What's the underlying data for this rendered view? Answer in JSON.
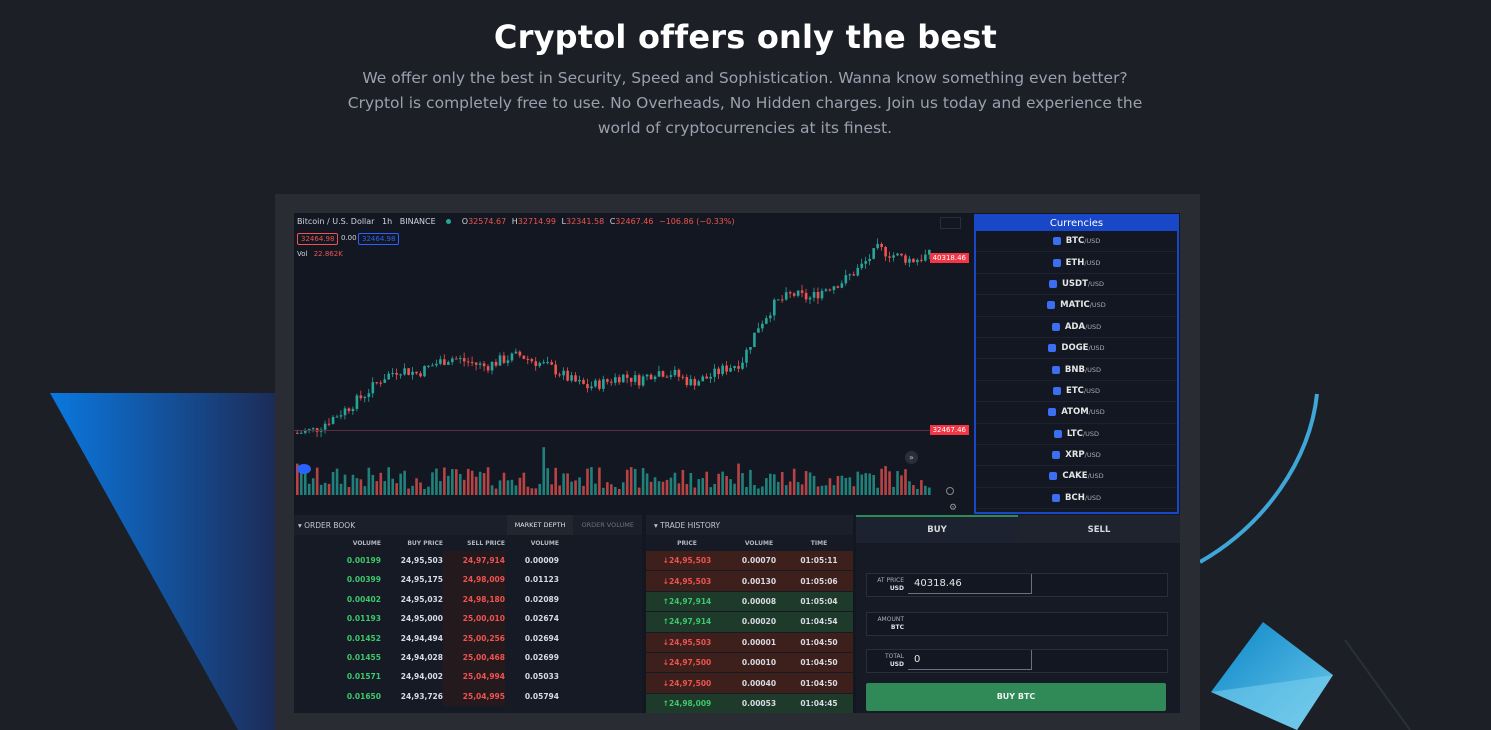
{
  "hero": {
    "title": "Cryptol offers only the best",
    "subtitle_lines": [
      "We offer only the best in Security, Speed and Sophistication. Wanna know something even better?",
      "Cryptol is completely free to use. No Overheads, No Hidden charges. Join us today and experience the",
      "world of cryptocurrencies at its finest."
    ]
  },
  "chart": {
    "symbol": "Bitcoin / U.S. Dollar",
    "interval": "1h",
    "exchange": "BINANCE",
    "o_label": "O",
    "o": "32574.67",
    "h_label": "H",
    "h": "32714.99",
    "l_label": "L",
    "l": "32341.58",
    "c_label": "C",
    "c": "32467.46",
    "change": "−106.86 (−0.33%)",
    "bid": "32464.98",
    "spread": "0.00",
    "ask": "32464.98",
    "vol_label": "Vol",
    "vol_value": "22.862K",
    "last_price_tag": "40318.46",
    "mid_price_tag": "32467.46"
  },
  "chart_data": {
    "type": "candlestick",
    "title": "Bitcoin / U.S. Dollar",
    "interval": "1h",
    "open": 32574.67,
    "high": 32714.99,
    "low": 32341.58,
    "close": 32467.46,
    "last_price": 40318.46,
    "trend_closes": [
      32467,
      32600,
      33100,
      33600,
      34200,
      34900,
      35300,
      35100,
      35500,
      35800,
      35600,
      35400,
      35700,
      35900,
      35600,
      35300,
      34800,
      34500,
      34700,
      35000,
      34800,
      35200,
      35100,
      34700,
      34900,
      35300,
      35600,
      37200,
      38200,
      38600,
      38400,
      38900,
      39200,
      39800,
      40600,
      40300,
      40100,
      40318
    ],
    "volume_label": "22.862K",
    "colors": {
      "up": "#26a69a",
      "down": "#ef5350"
    }
  },
  "currencies": {
    "title": "Currencies",
    "items": [
      {
        "sym": "BTC",
        "quote": "/USD",
        "icon": "bitcoin-icon",
        "color": "#3b6ef0"
      },
      {
        "sym": "ETH",
        "quote": "/USD",
        "icon": "ethereum-icon",
        "color": "#3b6ef0"
      },
      {
        "sym": "USDT",
        "quote": "/USD",
        "icon": "tether-icon",
        "color": "#3b6ef0"
      },
      {
        "sym": "MATIC",
        "quote": "/USD",
        "icon": "polygon-icon",
        "color": "#3b6ef0"
      },
      {
        "sym": "ADA",
        "quote": "/USD",
        "icon": "cardano-icon",
        "color": "#3b6ef0"
      },
      {
        "sym": "DOGE",
        "quote": "/USD",
        "icon": "dogecoin-icon",
        "color": "#3b6ef0"
      },
      {
        "sym": "BNB",
        "quote": "/USD",
        "icon": "binance-coin-icon",
        "color": "#3b6ef0"
      },
      {
        "sym": "ETC",
        "quote": "/USD",
        "icon": "ethereum-classic-icon",
        "color": "#3b6ef0"
      },
      {
        "sym": "ATOM",
        "quote": "/USD",
        "icon": "cosmos-icon",
        "color": "#3b6ef0"
      },
      {
        "sym": "LTC",
        "quote": "/USD",
        "icon": "litecoin-icon",
        "color": "#3b6ef0"
      },
      {
        "sym": "XRP",
        "quote": "/USD",
        "icon": "ripple-icon",
        "color": "#3b6ef0"
      },
      {
        "sym": "CAKE",
        "quote": "/USD",
        "icon": "pancakeswap-icon",
        "color": "#3b6ef0"
      },
      {
        "sym": "BCH",
        "quote": "/USD",
        "icon": "bitcoin-cash-icon",
        "color": "#3b6ef0"
      }
    ]
  },
  "order_book": {
    "title": "ORDER BOOK",
    "tabs": [
      "MARKET DEPTH",
      "ORDER VOLUME"
    ],
    "columns": [
      "VOLUME",
      "BUY PRICE",
      "SELL PRICE",
      "VOLUME"
    ],
    "rows": [
      [
        "0.00199",
        "24,95,503",
        "24,97,914",
        "0.00009"
      ],
      [
        "0.00399",
        "24,95,175",
        "24,98,009",
        "0.01123"
      ],
      [
        "0.00402",
        "24,95,032",
        "24,98,180",
        "0.02089"
      ],
      [
        "0.01193",
        "24,95,000",
        "25,00,010",
        "0.02674"
      ],
      [
        "0.01452",
        "24,94,494",
        "25,00,256",
        "0.02694"
      ],
      [
        "0.01455",
        "24,94,028",
        "25,00,468",
        "0.02699"
      ],
      [
        "0.01571",
        "24,94,002",
        "25,04,994",
        "0.05033"
      ],
      [
        "0.01650",
        "24,93,726",
        "25,04,995",
        "0.05794"
      ]
    ]
  },
  "trade_history": {
    "title": "TRADE HISTORY",
    "columns": [
      "PRICE",
      "VOLUME",
      "TIME"
    ],
    "rows": [
      {
        "dir": "down",
        "price": "24,95,503",
        "volume": "0.00070",
        "time": "01:05:11"
      },
      {
        "dir": "down",
        "price": "24,95,503",
        "volume": "0.00130",
        "time": "01:05:06"
      },
      {
        "dir": "up",
        "price": "24,97,914",
        "volume": "0.00008",
        "time": "01:05:04"
      },
      {
        "dir": "up",
        "price": "24,97,914",
        "volume": "0.00020",
        "time": "01:04:54"
      },
      {
        "dir": "down",
        "price": "24,95,503",
        "volume": "0.00001",
        "time": "01:04:50"
      },
      {
        "dir": "down",
        "price": "24,97,500",
        "volume": "0.00010",
        "time": "01:04:50"
      },
      {
        "dir": "down",
        "price": "24,97,500",
        "volume": "0.00040",
        "time": "01:04:50"
      },
      {
        "dir": "up",
        "price": "24,98,009",
        "volume": "0.00053",
        "time": "01:04:45"
      }
    ]
  },
  "trade_form": {
    "buy_tab": "BUY",
    "sell_tab": "SELL",
    "at_price_label": "AT PRICE",
    "at_price_unit": "USD",
    "at_price_value": "40318.46",
    "amount_label": "AMOUNT",
    "amount_unit": "BTC",
    "amount_value": "",
    "total_label": "TOTAL",
    "total_unit": "USD",
    "total_value": "0",
    "submit_label": "BUY BTC"
  },
  "colors": {
    "background": "#1c1f26",
    "panel": "#131722",
    "green": "#26a69a",
    "red": "#ef5350",
    "accent_blue": "#1848c8",
    "buy_button": "#2f8a58"
  }
}
